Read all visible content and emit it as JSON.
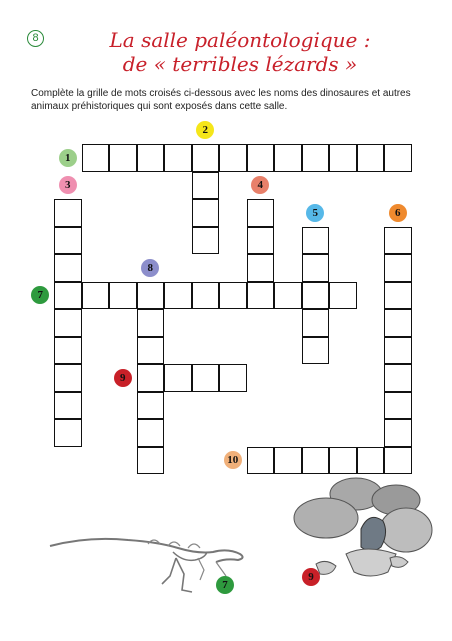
{
  "page_number": "8",
  "title": {
    "line1": "La salle paléontologique :",
    "line2": "de « terribles lézards »"
  },
  "instructions": "Complète la grille de mots croisés ci-dessous avec les noms des dinosaures et autres animaux préhistoriques qui sont exposés dans cette salle.",
  "crossword": {
    "clues": [
      {
        "number": "1",
        "direction": "across",
        "length": 12,
        "color": "#9ccf8a"
      },
      {
        "number": "2",
        "direction": "down",
        "length": 3,
        "color": "#f5e61a"
      },
      {
        "number": "3",
        "direction": "down",
        "length": 9,
        "color": "#ef8fb0"
      },
      {
        "number": "4",
        "direction": "down",
        "length": 4,
        "color": "#e8806a"
      },
      {
        "number": "5",
        "direction": "down",
        "length": 5,
        "color": "#56b8e8"
      },
      {
        "number": "6",
        "direction": "down",
        "length": 9,
        "color": "#ef8a2e"
      },
      {
        "number": "7",
        "direction": "across",
        "length": 11,
        "color": "#2e9a3e"
      },
      {
        "number": "8",
        "direction": "down",
        "length": 7,
        "color": "#8c8ecb"
      },
      {
        "number": "9",
        "direction": "across",
        "length": 4,
        "color": "#c82028"
      },
      {
        "number": "10",
        "direction": "across",
        "length": 6,
        "color": "#f0b07a"
      }
    ]
  },
  "illustration_labels": {
    "skeleton": "7",
    "eggs": "9"
  }
}
